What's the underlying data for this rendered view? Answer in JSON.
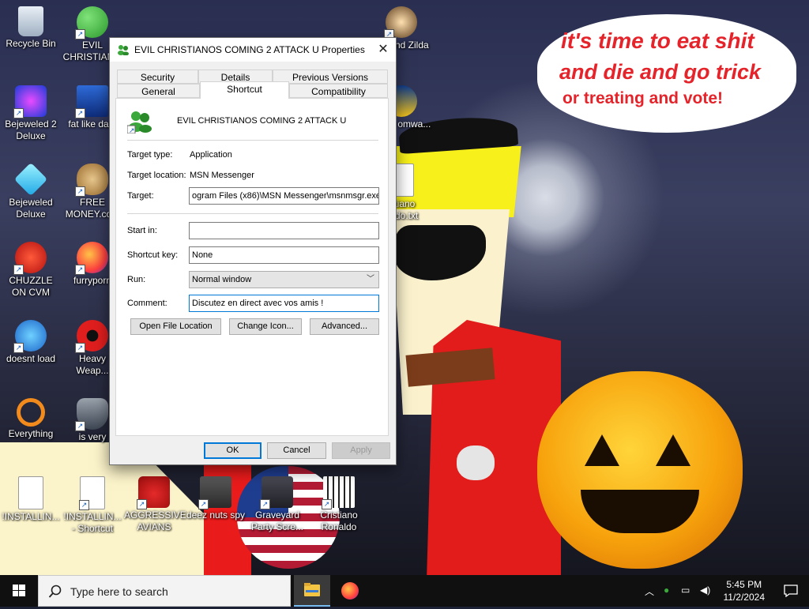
{
  "speech_bubble": {
    "line1": "it's time to eat shit",
    "line2": "and die and go trick",
    "line3": "or treating and vote!"
  },
  "desktop_icons": [
    {
      "label": "Recycle Bin",
      "icon": "recycle-bin-icon"
    },
    {
      "label": "EVIL CHRISTIAN...",
      "icon": "msn-messenger-icon"
    },
    {
      "label": "Bejeweled 2 Deluxe",
      "icon": "bejeweled-icon"
    },
    {
      "label": "fat like dark",
      "icon": "mpl-icon"
    },
    {
      "label": "Bejeweled Deluxe",
      "icon": "diamond-icon"
    },
    {
      "label": "FREE MONEY.co...",
      "icon": "money-bag-icon"
    },
    {
      "label": "CHUZZLE ON CVM",
      "icon": "chuzzle-icon"
    },
    {
      "label": "furryporn",
      "icon": "firefox-icon"
    },
    {
      "label": "doesnt load",
      "icon": "thunderbird-icon"
    },
    {
      "label": "Heavy Weap...",
      "icon": "radiation-icon"
    },
    {
      "label": "Everything",
      "icon": "search-icon"
    },
    {
      "label": "is very",
      "icon": "shield-icon"
    },
    {
      "label": "!INSTALLIN...",
      "icon": "text-file-icon"
    },
    {
      "label": "!INSTALLIN... - Shortcut",
      "icon": "text-file-icon"
    },
    {
      "label": "AGGRESSIVE AVIANS",
      "icon": "angry-bird-icon"
    },
    {
      "label": "deez nuts spy",
      "icon": "windows-stack-icon"
    },
    {
      "label": "Graveyard Party Scre...",
      "icon": "graveyard-icon"
    },
    {
      "label": "Cristiano Ronaldo",
      "icon": "pixel-cat-icon"
    },
    {
      "label": "Legend Zilda",
      "icon": "game-icon"
    },
    {
      "label": "naldo omwa...",
      "icon": "shield-icon"
    },
    {
      "label": "istiano ando.txt",
      "icon": "text-file-icon"
    }
  ],
  "dialog": {
    "title": "EVIL CHRISTIANOS COMING 2 ATTACK U Properties",
    "close_glyph": "✕",
    "tabs_row1": [
      "Security",
      "Details",
      "Previous Versions"
    ],
    "tabs_row2": [
      "General",
      "Shortcut",
      "Compatibility"
    ],
    "active_tab": "Shortcut",
    "shortcut_name": "EVIL CHRISTIANOS COMING 2 ATTACK U",
    "target_type_label": "Target type:",
    "target_type_value": "Application",
    "target_location_label": "Target location:",
    "target_location_value": "MSN Messenger",
    "target_label": "Target:",
    "target_value": "ogram Files (x86)\\MSN Messenger\\msnmsgr.exe\"",
    "start_in_label": "Start in:",
    "start_in_value": "",
    "shortcut_key_label": "Shortcut key:",
    "shortcut_key_value": "None",
    "run_label": "Run:",
    "run_value": "Normal window",
    "comment_label": "Comment:",
    "comment_value": "Discutez en direct avec vos amis !",
    "open_file_location": "Open File Location",
    "change_icon": "Change Icon...",
    "advanced": "Advanced...",
    "ok": "OK",
    "cancel": "Cancel",
    "apply": "Apply"
  },
  "taskbar": {
    "search_placeholder": "Type here to search",
    "time": "5:45 PM",
    "date": "11/2/2024"
  },
  "colors": {
    "accent": "#0078d7",
    "speech_text": "#e4242a",
    "taskbar": "#101010"
  }
}
